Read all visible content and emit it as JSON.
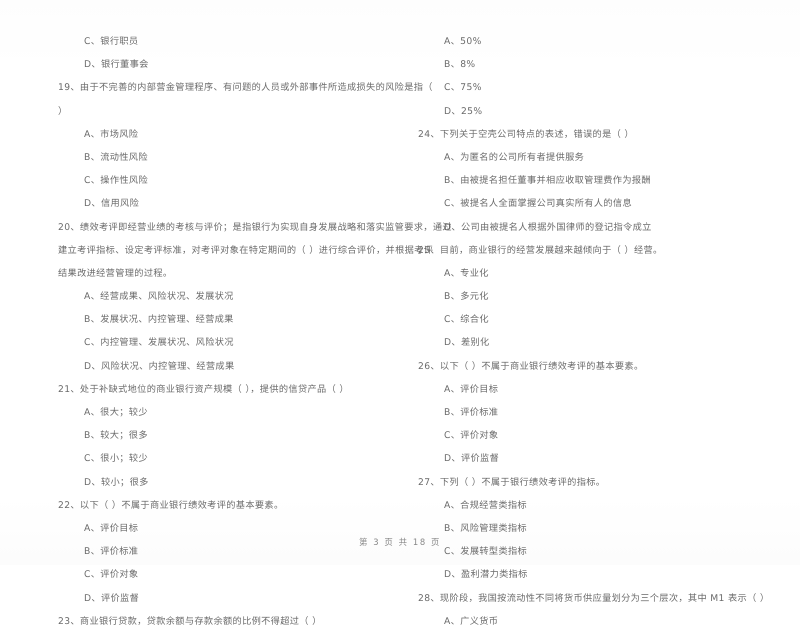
{
  "document": {
    "type": "scanned-exam-paper",
    "footer": "第 3 页 共 18 页",
    "page_number": "3",
    "total_pages": "18",
    "text_color": "#606060",
    "background_color": "#ffffff"
  },
  "left_column": {
    "lines": [
      {
        "kind": "option",
        "text": "C、银行职员"
      },
      {
        "kind": "option",
        "text": "D、银行董事会"
      },
      {
        "kind": "question",
        "text": "19、由于不完善的内部营金管理程序、有问题的人员或外部事件所造成损失的风险是指（"
      },
      {
        "kind": "question_cont",
        "text": "）"
      },
      {
        "kind": "option",
        "text": "A、市场风险"
      },
      {
        "kind": "option",
        "text": "B、流动性风险"
      },
      {
        "kind": "option",
        "text": "C、操作性风险"
      },
      {
        "kind": "option",
        "text": "D、信用风险"
      },
      {
        "kind": "question",
        "text": "20、绩效考评即经营业绩的考核与评价；是指银行为实现自身发展战略和落实监管要求，通过"
      },
      {
        "kind": "question_cont",
        "text": "建立考评指标、设定考评标准，对考评对象在特定期间的（      ）进行综合评价，并根据考评"
      },
      {
        "kind": "question_cont",
        "text": "结果改进经营管理的过程。"
      },
      {
        "kind": "option",
        "text": "A、经营成果、风险状况、发展状况"
      },
      {
        "kind": "option",
        "text": "B、发展状况、内控管理、经营成果"
      },
      {
        "kind": "option",
        "text": "C、内控管理、发展状况、风险状况"
      },
      {
        "kind": "option",
        "text": "D、风险状况、内控管理、经营成果"
      },
      {
        "kind": "question",
        "text": "21、处于补缺式地位的商业银行资产规模（      ），提供的信贷产品（      ）"
      },
      {
        "kind": "option",
        "text": "A、很大；较少"
      },
      {
        "kind": "option",
        "text": "B、较大；很多"
      },
      {
        "kind": "option",
        "text": "C、很小；较少"
      },
      {
        "kind": "option",
        "text": "D、较小；很多"
      },
      {
        "kind": "question",
        "text": "22、以下（      ）不属于商业银行绩效考评的基本要素。"
      },
      {
        "kind": "option",
        "text": "A、评价目标"
      },
      {
        "kind": "option",
        "text": "B、评价标准"
      },
      {
        "kind": "option",
        "text": "C、评价对象"
      },
      {
        "kind": "option",
        "text": "D、评价监督"
      },
      {
        "kind": "question",
        "text": "23、商业银行贷款，贷款余额与存款余额的比例不得超过（      ）"
      }
    ]
  },
  "right_column": {
    "lines": [
      {
        "kind": "option",
        "text": "A、50%"
      },
      {
        "kind": "option",
        "text": "B、8%"
      },
      {
        "kind": "option",
        "text": "C、75%"
      },
      {
        "kind": "option",
        "text": "D、25%"
      },
      {
        "kind": "question",
        "text": "24、下列关于空壳公司特点的表述，错误的是（      ）"
      },
      {
        "kind": "option",
        "text": "A、为匿名的公司所有者提供服务"
      },
      {
        "kind": "option",
        "text": "B、由被提名担任董事并相应收取管理费作为报酬"
      },
      {
        "kind": "option",
        "text": "C、被提名人全面掌握公司真实所有人的信息"
      },
      {
        "kind": "option",
        "text": "D、公司由被提名人根据外国律师的登记指令成立"
      },
      {
        "kind": "question",
        "text": "25、目前，商业银行的经营发展越来越倾向于（      ）经营。"
      },
      {
        "kind": "option",
        "text": "A、专业化"
      },
      {
        "kind": "option",
        "text": "B、多元化"
      },
      {
        "kind": "option",
        "text": "C、综合化"
      },
      {
        "kind": "option",
        "text": "D、差别化"
      },
      {
        "kind": "question",
        "text": "26、以下（      ）不属于商业银行绩效考评的基本要素。"
      },
      {
        "kind": "option",
        "text": "A、评价目标"
      },
      {
        "kind": "option",
        "text": "B、评价标准"
      },
      {
        "kind": "option",
        "text": "C、评价对象"
      },
      {
        "kind": "option",
        "text": "D、评价监督"
      },
      {
        "kind": "question",
        "text": "27、下列（      ）不属于银行绩效考评的指标。"
      },
      {
        "kind": "option",
        "text": "A、合规经营类指标"
      },
      {
        "kind": "option",
        "text": "B、风险管理类指标"
      },
      {
        "kind": "option",
        "text": "C、发展转型类指标"
      },
      {
        "kind": "option",
        "text": "D、盈利潜力类指标"
      },
      {
        "kind": "question",
        "text": "28、现阶段，我国按流动性不同将货币供应量划分为三个层次，其中 M1 表示（      ）"
      },
      {
        "kind": "option",
        "text": "A、广义货币"
      }
    ]
  }
}
